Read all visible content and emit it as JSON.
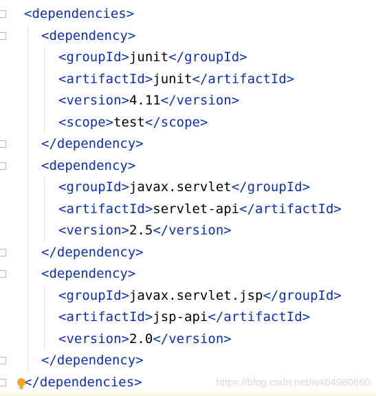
{
  "editor": {
    "lines": [
      {
        "open": "<",
        "tag": "dependencies",
        "close": ">",
        "text": "",
        "etag": ""
      },
      {
        "open": "<",
        "tag": "dependency",
        "close": ">",
        "text": "",
        "etag": ""
      },
      {
        "open": "<",
        "tag": "groupId",
        "close": ">",
        "text": "junit",
        "etag": "groupId"
      },
      {
        "open": "<",
        "tag": "artifactId",
        "close": ">",
        "text": "junit",
        "etag": "artifactId"
      },
      {
        "open": "<",
        "tag": "version",
        "close": ">",
        "text": "4.11",
        "etag": "version"
      },
      {
        "open": "<",
        "tag": "scope",
        "close": ">",
        "text": "test",
        "etag": "scope"
      },
      {
        "open": "</",
        "tag": "dependency",
        "close": ">",
        "text": "",
        "etag": ""
      },
      {
        "open": "<",
        "tag": "dependency",
        "close": ">",
        "text": "",
        "etag": ""
      },
      {
        "open": "<",
        "tag": "groupId",
        "close": ">",
        "text": "javax.servlet",
        "etag": "groupId"
      },
      {
        "open": "<",
        "tag": "artifactId",
        "close": ">",
        "text": "servlet-api",
        "etag": "artifactId"
      },
      {
        "open": "<",
        "tag": "version",
        "close": ">",
        "text": "2.5",
        "etag": "version"
      },
      {
        "open": "</",
        "tag": "dependency",
        "close": ">",
        "text": "",
        "etag": ""
      },
      {
        "open": "<",
        "tag": "dependency",
        "close": ">",
        "text": "",
        "etag": ""
      },
      {
        "open": "<",
        "tag": "groupId",
        "close": ">",
        "text": "javax.servlet.jsp",
        "etag": "groupId"
      },
      {
        "open": "<",
        "tag": "artifactId",
        "close": ">",
        "text": "jsp-api",
        "etag": "artifactId"
      },
      {
        "open": "<",
        "tag": "version",
        "close": ">",
        "text": "2.0",
        "etag": "version"
      },
      {
        "open": "</",
        "tag": "dependency",
        "close": ">",
        "text": "",
        "etag": ""
      },
      {
        "open": "</",
        "tag": "dependencies",
        "close": ">",
        "text": "",
        "etag": ""
      }
    ]
  },
  "colors": {
    "tag": "#0a2fb0",
    "text": "#000000",
    "watermark": "#d9d9d9",
    "bulb": "#f5a623"
  },
  "icons": {
    "intention": "lightbulb-icon",
    "fold": "fold-marker-icon"
  },
  "watermark": "https://blog.csdn.net/w464960660"
}
